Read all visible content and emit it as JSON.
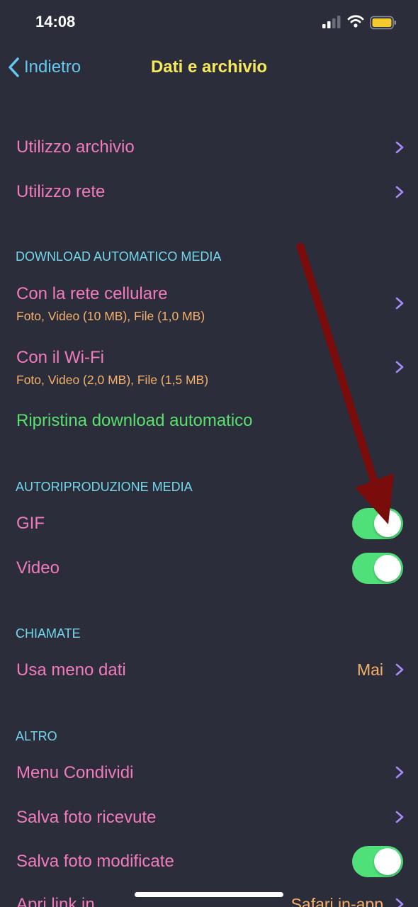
{
  "status_bar": {
    "time": "14:08"
  },
  "nav": {
    "back_label": "Indietro",
    "title": "Dati e archivio"
  },
  "colors": {
    "background": "#2b2d3b",
    "row_label": "#f17bbd",
    "section_header": "#73d8ec",
    "subtitle": "#f5b16b",
    "chevron": "#a78bfa",
    "toggle_on": "#4fe07a",
    "title": "#f6e95a",
    "back": "#66c7ee",
    "annotation_arrow": "#7a0c0c"
  },
  "usage": {
    "storage_label": "Utilizzo archivio",
    "network_label": "Utilizzo rete"
  },
  "auto_download": {
    "header": "DOWNLOAD AUTOMATICO MEDIA",
    "cellular": {
      "label": "Con la rete cellulare",
      "detail": "Foto, Video (10 MB), File (1,0 MB)"
    },
    "wifi": {
      "label": "Con il Wi-Fi",
      "detail": "Foto, Video (2,0 MB), File (1,5 MB)"
    },
    "reset_label": "Ripristina download automatico"
  },
  "autoplay": {
    "header": "AUTORIPRODUZIONE MEDIA",
    "gif": {
      "label": "GIF",
      "on": true
    },
    "video": {
      "label": "Video",
      "on": true
    }
  },
  "calls": {
    "header": "CHIAMATE",
    "less_data": {
      "label": "Usa meno dati",
      "value": "Mai"
    }
  },
  "other": {
    "header": "ALTRO",
    "share_menu": {
      "label": "Menu Condividi"
    },
    "save_received": {
      "label": "Salva foto ricevute"
    },
    "save_edited": {
      "label": "Salva foto modificate",
      "on": true
    },
    "open_links": {
      "label": "Apri link in",
      "value": "Safari in-app"
    }
  }
}
